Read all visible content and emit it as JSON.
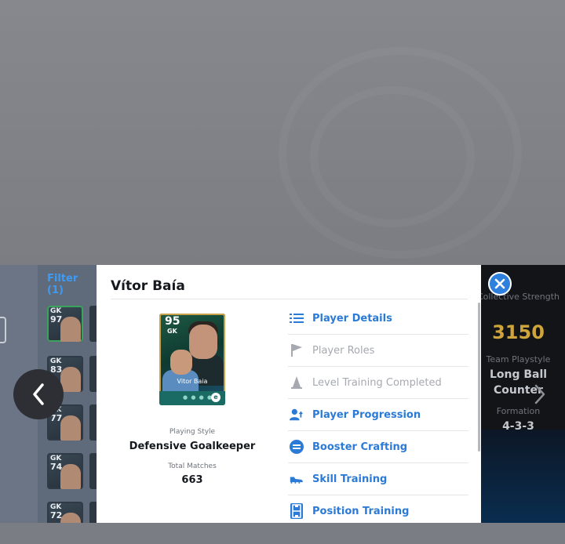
{
  "player": {
    "name": "Vítor Baía",
    "rating": "95",
    "position": "GK",
    "card_name": "Vitor Baia",
    "playing_style_label": "Playing Style",
    "playing_style": "Defensive Goalkeeper",
    "total_matches_label": "Total Matches",
    "total_matches": "663"
  },
  "menu": [
    {
      "label": "Player Details",
      "icon": "list-icon",
      "enabled": true
    },
    {
      "label": "Player Roles",
      "icon": "flag-icon",
      "enabled": false
    },
    {
      "label": "Level Training Completed",
      "icon": "cone-icon",
      "enabled": false
    },
    {
      "label": "Player Progression",
      "icon": "person-up-icon",
      "enabled": true
    },
    {
      "label": "Booster Crafting",
      "icon": "booster-icon",
      "enabled": true
    },
    {
      "label": "Skill Training",
      "icon": "boot-icon",
      "enabled": true
    },
    {
      "label": "Position Training",
      "icon": "pitch-icon",
      "enabled": true
    }
  ],
  "list_panel": {
    "filter_label": "Filter (1)",
    "cards": [
      {
        "pos": "GK",
        "rating": "97"
      },
      {
        "pos": "GK",
        "rating": "83"
      },
      {
        "pos": "GK",
        "rating": "77"
      },
      {
        "pos": "GK",
        "rating": "74"
      },
      {
        "pos": "GK",
        "rating": "72"
      }
    ]
  },
  "team_panel": {
    "strength_label": "Collective Strength",
    "strength_value": "3150",
    "playstyle_label": "Team Playstyle",
    "playstyle_value_line1": "Long Ball",
    "playstyle_value_line2": "Counter",
    "formation_label": "Formation",
    "formation_value": "4-3-3"
  },
  "colors": {
    "accent": "#2e80dc",
    "link": "#2b7bd6",
    "disabled": "#a6a9af",
    "strength": "#cfa53b"
  }
}
